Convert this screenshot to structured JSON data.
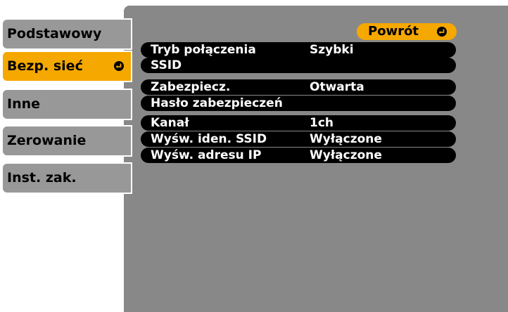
{
  "sidebar": {
    "items": [
      {
        "label": "Podstawowy"
      },
      {
        "label": "Bezp. sieć"
      },
      {
        "label": "Inne"
      },
      {
        "label": "Zerowanie"
      },
      {
        "label": "Inst. zak."
      }
    ]
  },
  "back_button": {
    "label": "Powrót"
  },
  "settings": {
    "rows": [
      {
        "label": "Tryb połączenia",
        "value": "Szybki"
      },
      {
        "label": "SSID",
        "value": ""
      },
      {
        "label": "Zabezpiecz.",
        "value": "Otwarta"
      },
      {
        "label": "Hasło zabezpieczeń",
        "value": ""
      },
      {
        "label": "Kanał",
        "value": "1ch"
      },
      {
        "label": "Wyśw. iden. SSID",
        "value": "Wyłączone"
      },
      {
        "label": "Wyśw. adresu IP",
        "value": "Wyłączone"
      }
    ]
  },
  "colors": {
    "accent": "#f5a800",
    "tab_inactive": "#989898",
    "panel": "#888888",
    "row_bg": "#000000"
  },
  "icons": {
    "enter": "enter-icon"
  }
}
